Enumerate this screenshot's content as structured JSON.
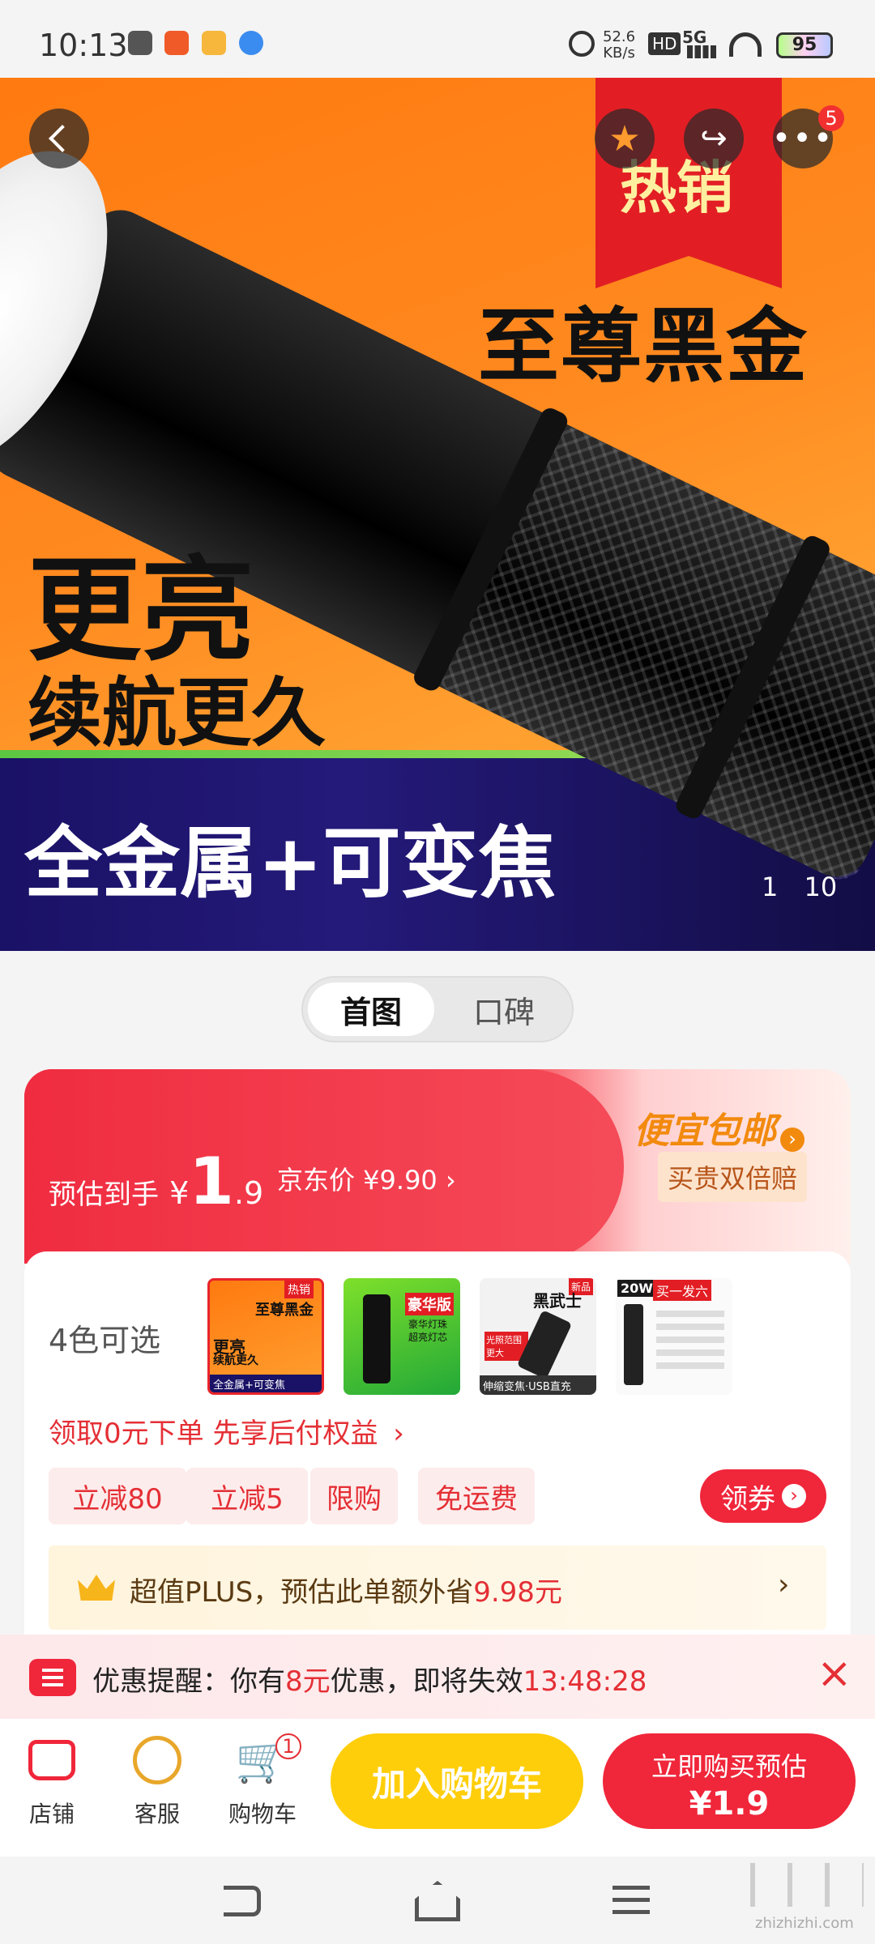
{
  "status_bar": {
    "time": "10:13",
    "net_speed_value": "52.6",
    "net_speed_unit": "KB/s",
    "hd": "HD",
    "signal": "5G",
    "battery": "95"
  },
  "hero": {
    "hot_tag": "热销",
    "headline_right": "至尊黑金",
    "headline_left_1": "更亮",
    "headline_left_2": "续航更久",
    "bottom_text": "全金属+可变焦",
    "more_badge": "5",
    "image_index": "1",
    "image_total": "10"
  },
  "tabs": {
    "items": [
      {
        "label": "首图",
        "active": true
      },
      {
        "label": "口碑",
        "active": false
      }
    ]
  },
  "price": {
    "estimate_label": "预估到手",
    "currency": "¥",
    "integer": "1",
    "decimal": ".9",
    "jd_price_label": "京东价 ¥9.90",
    "jd_arrow": "›",
    "cheap_shipping": "便宜包邮",
    "double_comp": "买贵双倍赔"
  },
  "variants": {
    "label": "4色可选",
    "thumbs": [
      {
        "tag": "热销",
        "title": "至尊黑金",
        "line1": "更亮",
        "line2": "续航更久",
        "bottom": "全金属+可变焦"
      },
      {
        "title": "豪华版",
        "sub1": "豪华灯珠",
        "sub2": "超亮灯芯"
      },
      {
        "title": "黑武士",
        "corner": "新品",
        "side": "光照范围更大",
        "bottom": "伸缩变焦·USB直充"
      },
      {
        "title": "20W",
        "sub": "买一发六"
      }
    ]
  },
  "pay_later": {
    "text": "领取0元下单 先享后付权益",
    "arrow": "›"
  },
  "chips": [
    "立减80",
    "立减5",
    "限购",
    "免运费"
  ],
  "coupon_button": "领券",
  "plus_bar": {
    "prefix": "超值PLUS，预估此单额外省",
    "amount": "9.98元",
    "arrow": "›"
  },
  "promo_strip": {
    "label": "优惠提醒：你有",
    "amount": "8元",
    "middle": "优惠，即将失效",
    "countdown": "13:48:28",
    "close": "×"
  },
  "bottom_bar": {
    "shop": "店铺",
    "service": "客服",
    "cart": "购物车",
    "cart_count": "1",
    "add_to_cart": "加入购物车",
    "buy_now_line1": "立即购买预估",
    "buy_now_line2": "¥1.9"
  },
  "watermark": "zhizhizhi.com",
  "colors": {
    "brand_red": "#f0263a",
    "yellow": "#ffce0a",
    "orange": "#ff7a10",
    "navy": "#1a1266"
  }
}
